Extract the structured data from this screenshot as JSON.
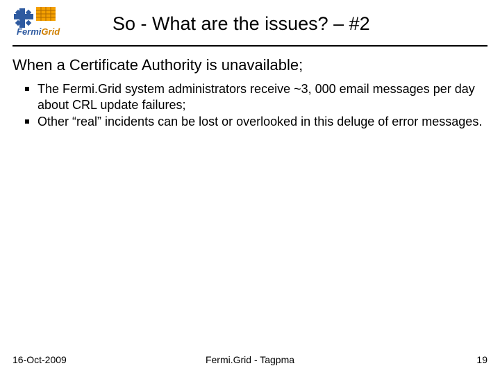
{
  "slide": {
    "title": "So - What are the issues? – #2",
    "subhead": "When a Certificate Authority is unavailable;",
    "bullets": [
      "The Fermi.Grid system administrators receive ~3, 000 email messages per day about CRL update failures;",
      "Other “real” incidents can be lost or overlooked in this deluge of error messages."
    ]
  },
  "footer": {
    "date": "16-Oct-2009",
    "center": "Fermi.Grid - Tagpma",
    "page": "19"
  },
  "logo": {
    "name": "FermiGrid"
  }
}
